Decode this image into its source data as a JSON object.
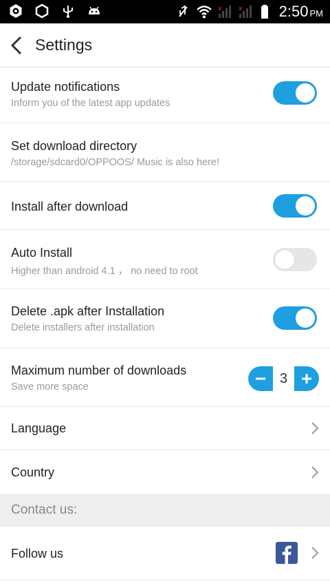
{
  "status_bar": {
    "time": "2:50",
    "ampm": "PM",
    "icons": [
      "settings-ring-icon",
      "hexagon-icon",
      "usb-icon",
      "android-icon",
      "mute-icon",
      "wifi-icon",
      "signal-icon",
      "signal-icon",
      "battery-icon"
    ]
  },
  "header": {
    "title": "Settings"
  },
  "settings": {
    "update_notifications": {
      "label": "Update notifications",
      "sub": "Inform you of the latest app updates",
      "enabled": true
    },
    "download_directory": {
      "label": "Set download directory",
      "sub": "/storage/sdcard0/OPPOOS/  Music is also here!"
    },
    "install_after_download": {
      "label": "Install after download",
      "enabled": true
    },
    "auto_install": {
      "label": "Auto Install",
      "sub": "Higher than android 4.1 ， no need to root",
      "enabled": false
    },
    "delete_apk": {
      "label": "Delete .apk after Installation",
      "sub": "Delete installers after installation",
      "enabled": true
    },
    "max_downloads": {
      "label": "Maximum number of downloads",
      "sub": "Save more space",
      "value": "3"
    },
    "language": {
      "label": "Language"
    },
    "country": {
      "label": "Country"
    }
  },
  "contact": {
    "section_label": "Contact us:",
    "follow_us": {
      "label": "Follow us"
    }
  },
  "colors": {
    "accent": "#1e9fe0",
    "facebook": "#3b5998",
    "section_bg": "#eeeeee"
  }
}
